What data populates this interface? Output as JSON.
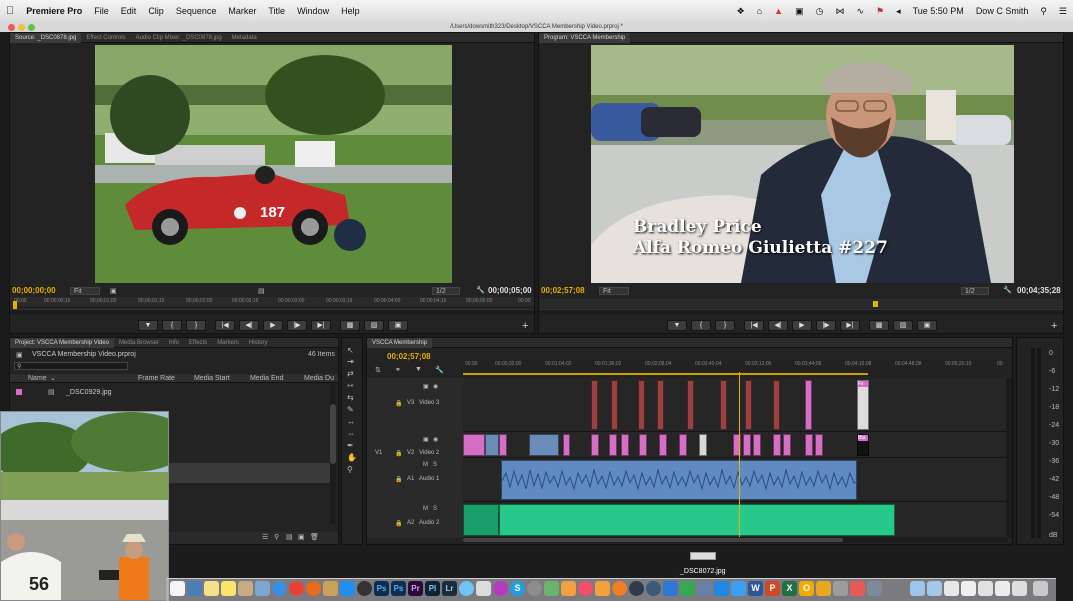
{
  "menubar": {
    "apple_icon": "apple-icon",
    "app_name": "Premiere Pro",
    "menus": [
      "File",
      "Edit",
      "Clip",
      "Sequence",
      "Marker",
      "Title",
      "Window",
      "Help"
    ],
    "clock": "Tue 5:50 PM",
    "user": "Dow C Smith"
  },
  "titlebar": {
    "path": "/Users/dowsmith323/Desktop/VSCCA Membership Video.prproj *"
  },
  "source_monitor": {
    "tabs": [
      "Source: _DSC0878.jpg",
      "Effect Controls",
      "Audio Clip Mixer: _DSC0878.jpg",
      "Metadata"
    ],
    "timecode_in": "00;00;00;00",
    "fit": "Fit",
    "resolution": "1/2",
    "timecode_duration": "00;00;05;00",
    "ruler_ticks": [
      "00;00",
      "00;00;00;15",
      "00;00;01;00",
      "00;00;01;15",
      "00;00;02;00",
      "00;00;02;15",
      "00;00;03;00",
      "00;00;03;15",
      "00;00;04;00",
      "00;00;04;15",
      "00;00;05;00",
      "00;00"
    ]
  },
  "program_monitor": {
    "tabs": [
      "Program: VSCCA Membership"
    ],
    "timecode_in": "00;02;57;08",
    "fit": "Fit",
    "resolution": "1/2",
    "timecode_duration": "00;04;35;28",
    "title_line1": "Bradley Price",
    "title_line2": "Alfa Romeo Giulietta #227"
  },
  "project_panel": {
    "tabs": [
      "Project: VSCCA Membership Video",
      "Media Browser",
      "Info",
      "Effects",
      "Markers",
      "History"
    ],
    "project_file": "VSCCA Membership Video.prproj",
    "item_count": "46 Items",
    "columns": [
      "Name",
      "Frame Rate",
      "Media Start",
      "Media End",
      "Media Du"
    ],
    "first_item": "_DSC0929.jpg"
  },
  "timeline": {
    "tab": "VSCCA Membership",
    "playhead": "00;02;57;08",
    "ruler": [
      "00;00",
      "00;00;32;00",
      "00;01;04;02",
      "00;01;36;02",
      "00;02;08;04",
      "00;02;40;04",
      "00;03;12;06",
      "00;03;44;06",
      "00;04;16;08",
      "00;04;48;08",
      "00;05;20;10",
      "00"
    ],
    "tracks": {
      "v3": "V3",
      "v3_name": "Video 3",
      "v2": "V2",
      "v2_name": "Video 2",
      "v1": "V1",
      "a1": "A1",
      "a1_name": "Audio 1",
      "a2": "A2",
      "a2_name": "Audio 2"
    },
    "clip_labels": {
      "fx": "Fx",
      "bla": "Bla"
    }
  },
  "meter_scale": [
    "0",
    "-6",
    "-12",
    "-18",
    "-24",
    "-30",
    "-36",
    "-42",
    "-48",
    "-54",
    "dB"
  ],
  "drag_preview": {
    "filename": "_DSC8072.jpg"
  },
  "dock": {
    "app_labels": [
      "Ps",
      "Ps",
      "Pr",
      "Pl",
      "Lr",
      "S",
      "W",
      "P",
      "X",
      "O"
    ]
  }
}
